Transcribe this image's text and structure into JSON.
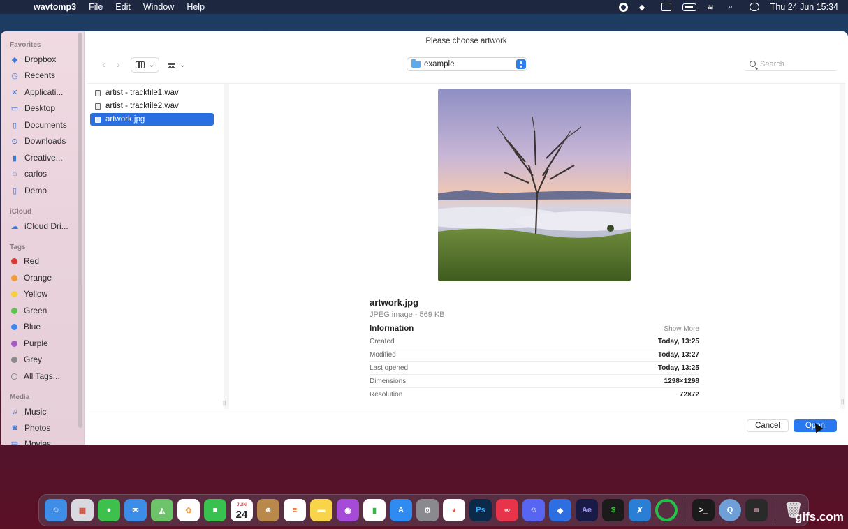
{
  "menubar": {
    "app_name": "wavtomp3",
    "menus": [
      "File",
      "Edit",
      "Window",
      "Help"
    ],
    "clock": "Thu 24 Jun  15:34"
  },
  "dialog": {
    "title": "Please choose artwork",
    "location": "example",
    "search_placeholder": "Search",
    "sidebar": {
      "favorites_header": "Favorites",
      "favorites": [
        {
          "label": "Dropbox",
          "icon": "dropbox-icon"
        },
        {
          "label": "Recents",
          "icon": "clock-icon"
        },
        {
          "label": "Applicati...",
          "icon": "applications-icon"
        },
        {
          "label": "Desktop",
          "icon": "desktop-icon"
        },
        {
          "label": "Documents",
          "icon": "document-icon"
        },
        {
          "label": "Downloads",
          "icon": "download-icon"
        },
        {
          "label": "Creative...",
          "icon": "document-icon"
        },
        {
          "label": "carlos",
          "icon": "home-icon"
        },
        {
          "label": "Demo",
          "icon": "document-icon"
        }
      ],
      "icloud_header": "iCloud",
      "icloud": [
        {
          "label": "iCloud Dri...",
          "icon": "cloud-icon"
        }
      ],
      "tags_header": "Tags",
      "tags": [
        {
          "label": "Red",
          "color": "#d83a33"
        },
        {
          "label": "Orange",
          "color": "#f19a38"
        },
        {
          "label": "Yellow",
          "color": "#f6cf3d"
        },
        {
          "label": "Green",
          "color": "#5bc24d"
        },
        {
          "label": "Blue",
          "color": "#3d86ef"
        },
        {
          "label": "Purple",
          "color": "#a65bc7"
        },
        {
          "label": "Grey",
          "color": "#8c8c8f"
        },
        {
          "label": "All Tags...",
          "color": ""
        }
      ],
      "media_header": "Media",
      "media": [
        {
          "label": "Music",
          "icon": "music-icon"
        },
        {
          "label": "Photos",
          "icon": "camera-icon"
        },
        {
          "label": "Movies",
          "icon": "film-icon"
        }
      ]
    },
    "files": [
      {
        "name": "artist - tracktile1.wav",
        "selected": false
      },
      {
        "name": "artist - tracktile2.wav",
        "selected": false
      },
      {
        "name": "artwork.jpg",
        "selected": true
      }
    ],
    "preview": {
      "name": "artwork.jpg",
      "subtitle": "JPEG image - 569 KB",
      "info_header": "Information",
      "show_more": "Show More",
      "rows": [
        {
          "label": "Created",
          "value": "Today, 13:25"
        },
        {
          "label": "Modified",
          "value": "Today, 13:27"
        },
        {
          "label": "Last opened",
          "value": "Today, 13:25"
        },
        {
          "label": "Dimensions",
          "value": "1298×1298"
        },
        {
          "label": "Resolution",
          "value": "72×72"
        }
      ]
    },
    "buttons": {
      "cancel": "Cancel",
      "open": "Open"
    }
  },
  "dock": {
    "calendar_month": "JUIN",
    "calendar_day": "24",
    "apps": [
      {
        "name": "finder-icon",
        "color": "#3e8ee8"
      },
      {
        "name": "launchpad-icon",
        "color": "#d9d9e0"
      },
      {
        "name": "messages-icon",
        "color": "#3ec14c"
      },
      {
        "name": "mail-icon",
        "color": "#3b8de8"
      },
      {
        "name": "maps-icon",
        "color": "#6cc36a"
      },
      {
        "name": "photos-icon",
        "color": "#f0a04a"
      },
      {
        "name": "facetime-icon",
        "color": "#38c14f"
      },
      {
        "name": "calendar-icon",
        "color": "#ffffff"
      },
      {
        "name": "contacts-icon",
        "color": "#b9894c"
      },
      {
        "name": "reminders-icon",
        "color": "#ffffff"
      },
      {
        "name": "notes-icon",
        "color": "#f7d44a"
      },
      {
        "name": "podcasts-icon",
        "color": "#a54bd8"
      },
      {
        "name": "numbers-icon",
        "color": "#3cb34d"
      },
      {
        "name": "app-store-icon",
        "color": "#2f8bf0"
      },
      {
        "name": "system-preferences-icon",
        "color": "#8a8a8e"
      },
      {
        "name": "chrome-icon",
        "color": "#ffffff"
      },
      {
        "name": "photoshop-icon",
        "color": "#0b2a4a"
      },
      {
        "name": "creative-cloud-icon",
        "color": "#e8344a"
      },
      {
        "name": "discord-icon",
        "color": "#5865f2"
      },
      {
        "name": "dropbox-icon",
        "color": "#2d6fe0"
      },
      {
        "name": "after-effects-icon",
        "color": "#1a1a46"
      },
      {
        "name": "terminal-icon",
        "color": "#1b1b1b"
      },
      {
        "name": "vscode-icon",
        "color": "#2a7fd4"
      },
      {
        "name": "activity-ring-icon",
        "color": "#23c04a"
      }
    ],
    "recent": [
      {
        "name": "terminal-icon",
        "color": "#1b1b1b"
      },
      {
        "name": "quicktime-icon",
        "color": "#6e9fd6"
      },
      {
        "name": "console-icon",
        "color": "#2a2a2a"
      }
    ],
    "labels": {
      "photoshop": "Ps",
      "after_effects": "Ae"
    }
  },
  "watermark": "gifs.com"
}
